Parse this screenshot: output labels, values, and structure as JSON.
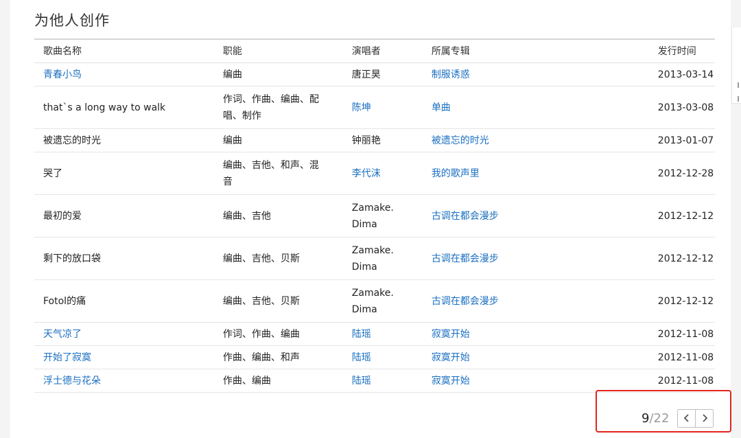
{
  "section_title": "为他人创作",
  "table": {
    "headers": [
      "歌曲名称",
      "职能",
      "演唱者",
      "所属专辑",
      "发行时间"
    ],
    "rows": [
      {
        "song": "青春小鸟",
        "song_link": true,
        "role": [
          "编曲"
        ],
        "singer": [
          "唐正昊"
        ],
        "singer_link": false,
        "album": "制服诱惑",
        "album_link": true,
        "date": "2013-03-14"
      },
      {
        "song": "that`s a long way to walk",
        "song_link": false,
        "role": [
          "作词、作曲、编曲、配",
          "唱、制作"
        ],
        "singer": [
          "陈坤"
        ],
        "singer_link": true,
        "album": "单曲",
        "album_link": true,
        "date": "2013-03-08"
      },
      {
        "song": "被遗忘的时光",
        "song_link": false,
        "role": [
          "编曲"
        ],
        "singer": [
          "钟丽艳"
        ],
        "singer_link": false,
        "album": "被遗忘的时光",
        "album_link": true,
        "date": "2013-01-07"
      },
      {
        "song": "哭了",
        "song_link": false,
        "role": [
          "编曲、吉他、和声、混",
          "音"
        ],
        "singer": [
          "李代沫"
        ],
        "singer_link": true,
        "album": "我的歌声里",
        "album_link": true,
        "date": "2012-12-28"
      },
      {
        "song": "最初的爱",
        "song_link": false,
        "role": [
          "编曲、吉他"
        ],
        "singer": [
          "Zamake.",
          "Dima"
        ],
        "singer_link": false,
        "album": "古调在都会漫步",
        "album_link": true,
        "date": "2012-12-12"
      },
      {
        "song": "剩下的放口袋",
        "song_link": false,
        "role": [
          "编曲、吉他、贝斯"
        ],
        "singer": [
          "Zamake.",
          "Dima"
        ],
        "singer_link": false,
        "album": "古调在都会漫步",
        "album_link": true,
        "date": "2012-12-12"
      },
      {
        "song": "Fotol的痛",
        "song_link": false,
        "role": [
          "编曲、吉他、贝斯"
        ],
        "singer": [
          "Zamake.",
          "Dima"
        ],
        "singer_link": false,
        "album": "古调在都会漫步",
        "album_link": true,
        "date": "2012-12-12"
      },
      {
        "song": "天气凉了",
        "song_link": true,
        "role": [
          "作词、作曲、编曲"
        ],
        "singer": [
          "陆瑶"
        ],
        "singer_link": true,
        "album": "寂寞开始",
        "album_link": true,
        "date": "2012-11-08"
      },
      {
        "song": "开始了寂寞",
        "song_link": true,
        "role": [
          "作曲、编曲、和声"
        ],
        "singer": [
          "陆瑶"
        ],
        "singer_link": true,
        "album": "寂寞开始",
        "album_link": true,
        "date": "2012-11-08"
      },
      {
        "song": "浮士德与花朵",
        "song_link": true,
        "role": [
          "作曲、编曲"
        ],
        "singer": [
          "陆瑶"
        ],
        "singer_link": true,
        "album": "寂寞开始",
        "album_link": true,
        "date": "2012-11-08"
      }
    ]
  },
  "pagination": {
    "current": "9",
    "separator": "/",
    "total": "22",
    "prev_icon": "chevron-left-icon",
    "next_icon": "chevron-right-icon"
  },
  "colors": {
    "link": "#1a6fc1",
    "highlight_border": "#e3241b"
  }
}
